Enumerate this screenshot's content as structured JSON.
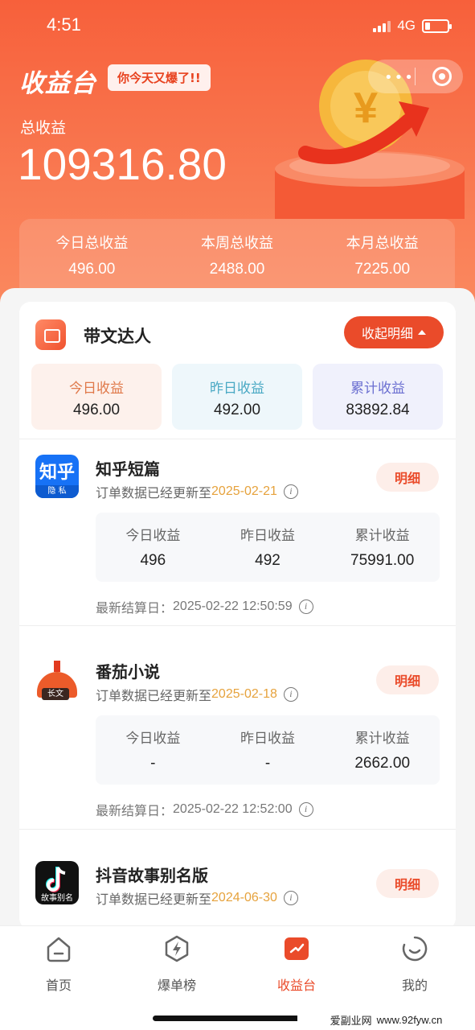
{
  "status_bar": {
    "time": "4:51",
    "network": "4G"
  },
  "header": {
    "brand": "收益台",
    "slogan": "你今天又爆了!!",
    "total_label": "总收益",
    "total_value": "109316.80",
    "summary": [
      {
        "label": "今日总收益",
        "value": "496.00"
      },
      {
        "label": "本周总收益",
        "value": "2488.00"
      },
      {
        "label": "本月总收益",
        "value": "7225.00"
      }
    ]
  },
  "section": {
    "title": "带文达人",
    "collapse_label": "收起明细",
    "stats": [
      {
        "label": "今日收益",
        "value": "496.00",
        "color": "#e0794a",
        "bg": "#fdf1ec"
      },
      {
        "label": "昨日收益",
        "value": "492.00",
        "color": "#4aa9c4",
        "bg": "#eef7fb"
      },
      {
        "label": "累计收益",
        "value": "83892.84",
        "color": "#6b6fd1",
        "bg": "#f0f1fc"
      }
    ]
  },
  "apps": [
    {
      "name": "知乎短篇",
      "sub_prefix": "订单数据已经更新至",
      "date": "2025-02-21",
      "detail": "明细",
      "logo_text": "知乎",
      "logo_badge": "隐 私",
      "stats": [
        {
          "label": "今日收益",
          "value": "496"
        },
        {
          "label": "昨日收益",
          "value": "492"
        },
        {
          "label": "累计收益",
          "value": "75991.00"
        }
      ],
      "settle_label": "最新结算日：",
      "settle_time": "2025-02-22 12:50:59"
    },
    {
      "name": "番茄小说",
      "sub_prefix": "订单数据已经更新至",
      "date": "2025-02-18",
      "detail": "明细",
      "logo_badge": "长文",
      "stats": [
        {
          "label": "今日收益",
          "value": "-"
        },
        {
          "label": "昨日收益",
          "value": "-"
        },
        {
          "label": "累计收益",
          "value": "2662.00"
        }
      ],
      "settle_label": "最新结算日：",
      "settle_time": "2025-02-22 12:52:00"
    },
    {
      "name": "抖音故事别名版",
      "sub_prefix": "订单数据已经更新至",
      "date": "2024-06-30",
      "detail": "明细",
      "logo_badge": "故事别名"
    }
  ],
  "tabbar": {
    "items": [
      {
        "label": "首页"
      },
      {
        "label": "爆单榜"
      },
      {
        "label": "收益台"
      },
      {
        "label": "我的"
      }
    ],
    "active_color": "#ea4b2a"
  },
  "watermark": {
    "site": "爱副业网",
    "url": "www.92fyw.cn"
  }
}
